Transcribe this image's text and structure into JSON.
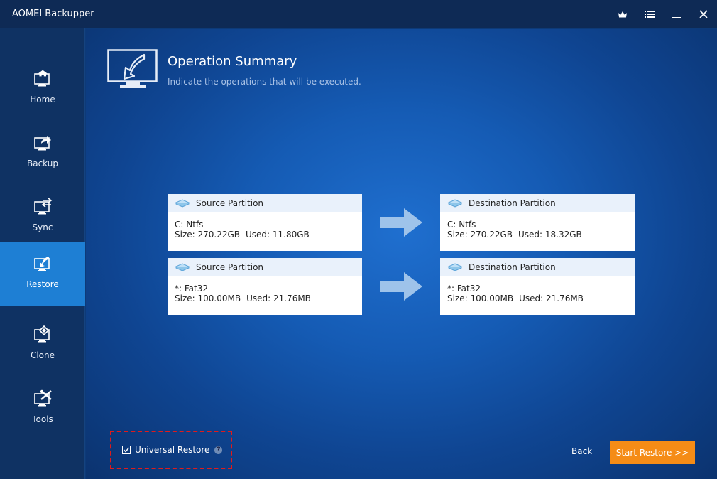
{
  "app": {
    "title": "AOMEI Backupper"
  },
  "window_controls": {
    "icons": [
      "crown-icon",
      "menu-icon",
      "minimize-icon",
      "close-icon"
    ]
  },
  "sidebar": {
    "items": [
      {
        "label": "Home",
        "icon": "home-icon",
        "active": false
      },
      {
        "label": "Backup",
        "icon": "backup-icon",
        "active": false
      },
      {
        "label": "Sync",
        "icon": "sync-icon",
        "active": false
      },
      {
        "label": "Restore",
        "icon": "restore-icon",
        "active": true
      },
      {
        "label": "Clone",
        "icon": "clone-icon",
        "active": false
      },
      {
        "label": "Tools",
        "icon": "tools-icon",
        "active": false
      }
    ]
  },
  "header": {
    "title": "Operation Summary",
    "subtitle": "Indicate the operations that will be executed."
  },
  "operations": [
    {
      "source": {
        "title": "Source Partition",
        "name": "C: Ntfs",
        "size": "Size: 270.22GB",
        "used": "Used: 11.80GB"
      },
      "destination": {
        "title": "Destination Partition",
        "name": "C: Ntfs",
        "size": "Size: 270.22GB",
        "used": "Used: 18.32GB"
      }
    },
    {
      "source": {
        "title": "Source Partition",
        "name": "*: Fat32",
        "size": "Size: 100.00MB",
        "used": "Used: 21.76MB"
      },
      "destination": {
        "title": "Destination Partition",
        "name": "*: Fat32",
        "size": "Size: 100.00MB",
        "used": "Used: 21.76MB"
      }
    }
  ],
  "footer": {
    "universal_restore_label": "Universal Restore",
    "universal_restore_checked": true,
    "back_label": "Back",
    "start_label": "Start Restore >>"
  },
  "colors": {
    "accent": "#1e7fd4",
    "start_button": "#f58c16",
    "highlight_box": "#e01b1b"
  }
}
